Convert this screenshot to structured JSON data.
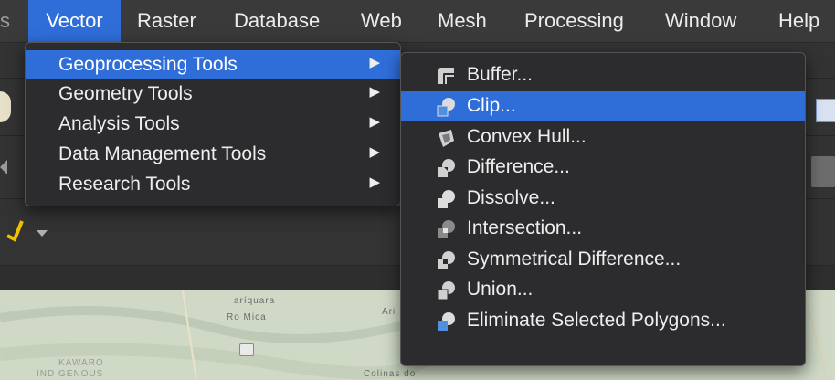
{
  "menubar": {
    "items": [
      {
        "label": "s"
      },
      {
        "label": "Vector"
      },
      {
        "label": "Raster"
      },
      {
        "label": "Database"
      },
      {
        "label": "Web"
      },
      {
        "label": "Mesh"
      },
      {
        "label": "Processing"
      },
      {
        "label": "Window"
      },
      {
        "label": "Help"
      }
    ],
    "active": "Vector"
  },
  "vector_menu": {
    "items": [
      {
        "label": "Geoprocessing Tools",
        "submenu_arrow": "▶"
      },
      {
        "label": "Geometry Tools",
        "submenu_arrow": "▶"
      },
      {
        "label": "Analysis Tools",
        "submenu_arrow": "▶"
      },
      {
        "label": "Data Management Tools",
        "submenu_arrow": "▶"
      },
      {
        "label": "Research Tools",
        "submenu_arrow": "▶"
      }
    ],
    "highlighted": "Geoprocessing Tools"
  },
  "geoprocessing_menu": {
    "items": [
      {
        "label": "Buffer...",
        "icon": "buffer-icon"
      },
      {
        "label": "Clip...",
        "icon": "clip-icon"
      },
      {
        "label": "Convex Hull...",
        "icon": "convex-hull-icon"
      },
      {
        "label": "Difference...",
        "icon": "difference-icon"
      },
      {
        "label": "Dissolve...",
        "icon": "dissolve-icon"
      },
      {
        "label": "Intersection...",
        "icon": "intersection-icon"
      },
      {
        "label": "Symmetrical Difference...",
        "icon": "symmetrical-difference-icon"
      },
      {
        "label": "Union...",
        "icon": "union-icon"
      },
      {
        "label": "Eliminate Selected Polygons...",
        "icon": "eliminate-polygons-icon"
      }
    ],
    "highlighted": "Clip..."
  },
  "map": {
    "labels": [
      "aríquara",
      "Ro Mica",
      "Ari",
      "KAWARO",
      "IND GENOUS",
      "Colinas do"
    ]
  },
  "colors": {
    "accent": "#2f6ed9",
    "menu_bg": "#2c2c2e",
    "menubar_bg": "#3a3a3a",
    "icon_light": "#dcdcdc",
    "icon_blue": "#4f8fe0"
  }
}
